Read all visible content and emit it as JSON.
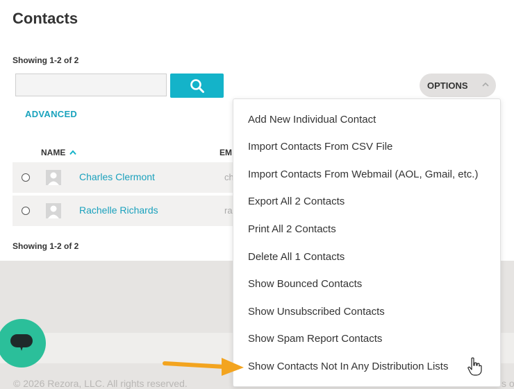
{
  "page": {
    "title": "Contacts"
  },
  "showing_top": "Showing 1-2 of 2",
  "showing_bottom": "Showing 1-2 of 2",
  "search": {
    "placeholder": "",
    "value": "",
    "button_icon": "search-icon"
  },
  "advanced": {
    "label": "ADVANCED"
  },
  "options": {
    "label": "OPTIONS",
    "expanded": true
  },
  "table": {
    "columns": {
      "name": "NAME",
      "email": "EM"
    },
    "sort_indicator": "chevron-up-icon",
    "rows": [
      {
        "name": "Charles Clermont",
        "email": "ch"
      },
      {
        "name": "Rachelle Richards",
        "email": "ra"
      }
    ]
  },
  "options_menu": {
    "items": [
      "Add New Individual Contact",
      "Import Contacts From CSV File",
      "Import Contacts From Webmail (AOL, Gmail, etc.)",
      "Export All 2 Contacts",
      "Print All 2 Contacts",
      "Delete All 1 Contacts",
      "Show Bounced Contacts",
      "Show Unsubscribed Contacts",
      "Show Spam Report Contacts",
      "Show Contacts Not In Any Distribution Lists"
    ]
  },
  "footer": {
    "copyright": "© 2026 Rezora, LLC. All rights reserved.",
    "right_fragment": "s o"
  },
  "colors": {
    "accent": "#14b3c9",
    "link": "#1ba1bd",
    "chat": "#2bbf9a",
    "arrow": "#f3a41f"
  }
}
